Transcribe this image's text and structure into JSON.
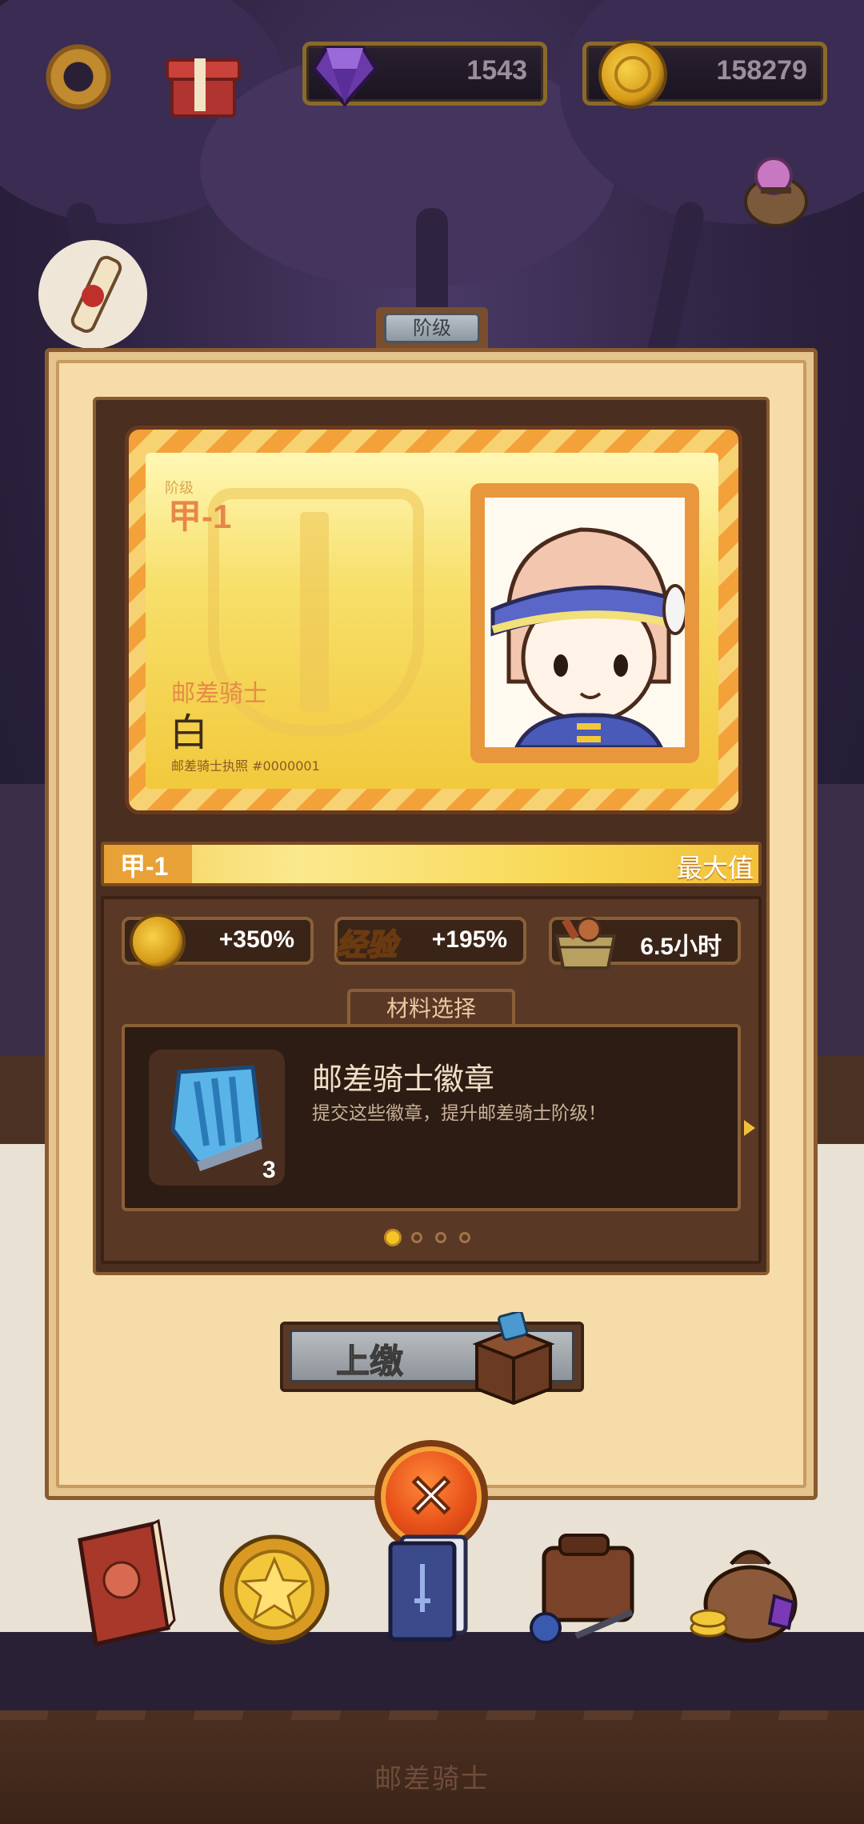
{
  "hud": {
    "gems": "1543",
    "coins": "158279"
  },
  "panel": {
    "tab_label": "阶级",
    "card": {
      "tier_label": "阶级",
      "tier": "甲-1",
      "class": "邮差骑士",
      "name": "白",
      "license": "邮差骑士执照 #0000001"
    },
    "rank_bar": {
      "tier": "甲-1",
      "status": "最大值",
      "progress": 1.0
    },
    "stats": [
      {
        "icon": "coin-icon",
        "value": "+350%"
      },
      {
        "label": "经验",
        "value": "+195%"
      },
      {
        "icon": "crate-icon",
        "value": "6.5小时"
      }
    ],
    "materials": {
      "tab_label": "材料选择",
      "title": "邮差骑士徽章",
      "description": "提交这些徽章，提升邮差骑士阶级！",
      "count": "3",
      "page_index": 1,
      "page_count": 4
    },
    "submit_label": "上缴"
  },
  "bottom": {
    "label": "邮差骑士"
  },
  "colors": {
    "panel": "#f6dca8",
    "dark_wood": "#4a2e1f",
    "gold": "#f5c526",
    "close_orange": "#e8521a"
  }
}
